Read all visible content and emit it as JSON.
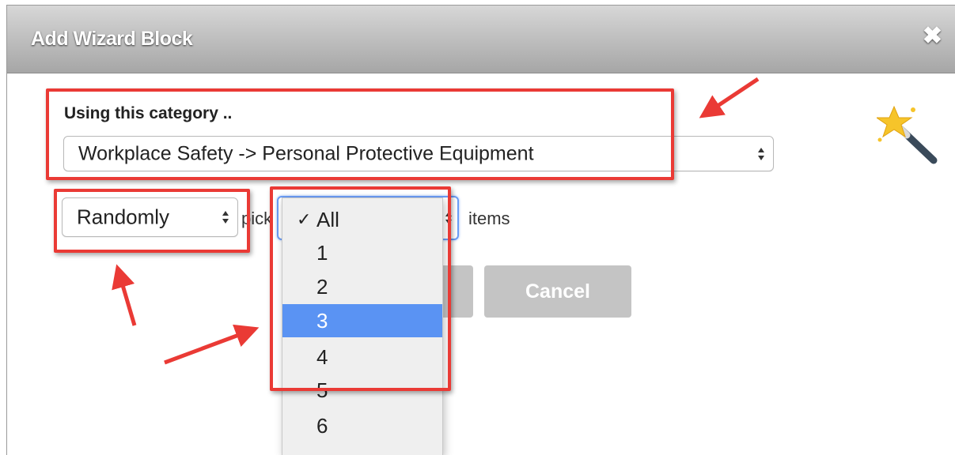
{
  "dialog": {
    "title": "Add Wizard Block",
    "close_icon": "close-icon",
    "close_glyph": "✖"
  },
  "category": {
    "label": "Using this category ..",
    "selected": "Workplace Safety -> Personal Protective Equipment"
  },
  "selection_mode": {
    "selected": "Randomly"
  },
  "pick": {
    "label": "pick",
    "suffix": "items"
  },
  "count_dropdown": {
    "check_mark": "✓",
    "options": [
      "All",
      "1",
      "2",
      "3",
      "4",
      "5",
      "6"
    ],
    "checked": "All",
    "highlighted": "3"
  },
  "buttons": {
    "cancel": "Cancel"
  },
  "icons": {
    "wizard": "magic-wand-icon",
    "updown": "up-down-arrows-icon"
  },
  "colors": {
    "annotation_red": "#ea3a35",
    "highlight_blue": "#5a93f3",
    "button_gray": "#c4c4c4"
  }
}
